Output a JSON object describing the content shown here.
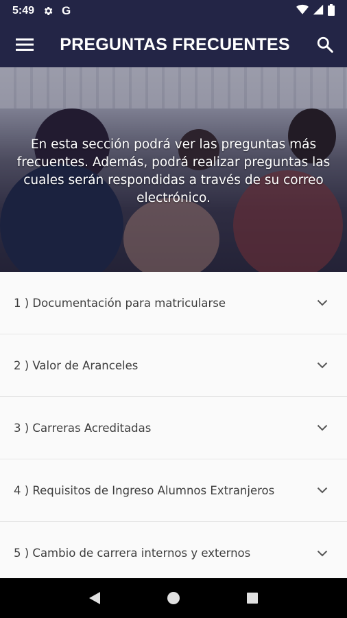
{
  "status_bar": {
    "time": "5:49",
    "icons": [
      "gear-icon",
      "google-icon",
      "wifi-icon",
      "signal-icon",
      "battery-icon"
    ],
    "google_letter": "G"
  },
  "app_bar": {
    "title": "PREGUNTAS FRECUENTES",
    "menu_icon": "hamburger-menu-icon",
    "search_icon": "search-icon",
    "background_color": "#232546"
  },
  "hero": {
    "description": "En esta sección podrá ver las preguntas más frecuentes. Además, podrá realizar preguntas las cuales serán respondidas a través de su correo electrónico."
  },
  "faq": {
    "items": [
      {
        "label": "1 ) Documentación para matricularse"
      },
      {
        "label": "2 ) Valor de Aranceles"
      },
      {
        "label": "3 ) Carreras Acreditadas"
      },
      {
        "label": "4 ) Requisitos de Ingreso Alumnos Extranjeros"
      },
      {
        "label": "5 ) Cambio de carrera internos y externos"
      }
    ],
    "expand_icon": "chevron-down-icon"
  },
  "nav_bar": {
    "icons": [
      "back-icon",
      "home-icon",
      "recents-icon"
    ]
  }
}
